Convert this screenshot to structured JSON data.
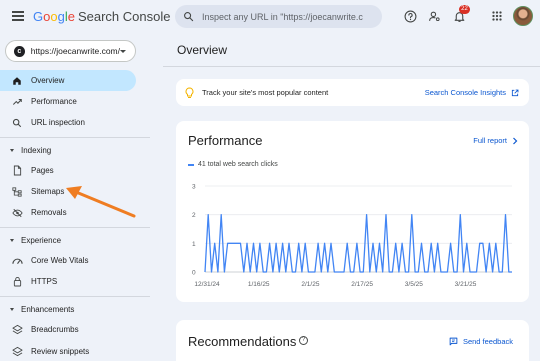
{
  "app": {
    "logo_google": [
      "G",
      "o",
      "o",
      "g",
      "l",
      "e"
    ],
    "logo_product": "Search Console"
  },
  "search": {
    "placeholder": "Inspect any URL in \"https://joecanwrite.c"
  },
  "topbar": {
    "icons": [
      "help-icon",
      "manage-users-icon",
      "notifications-icon",
      "apps-grid-icon"
    ],
    "notification_count": "22"
  },
  "property": {
    "url": "https://joecanwrite.com/"
  },
  "sidebar": {
    "items": [
      {
        "label": "Overview",
        "icon": "home-icon",
        "active": true
      },
      {
        "label": "Performance",
        "icon": "trending-icon"
      },
      {
        "label": "URL inspection",
        "icon": "search-icon"
      }
    ],
    "indexing": {
      "label": "Indexing",
      "items": [
        {
          "label": "Pages",
          "icon": "page-icon"
        },
        {
          "label": "Sitemaps",
          "icon": "sitemap-icon"
        },
        {
          "label": "Removals",
          "icon": "removals-icon"
        }
      ]
    },
    "experience": {
      "label": "Experience",
      "items": [
        {
          "label": "Core Web Vitals",
          "icon": "gauge-icon"
        },
        {
          "label": "HTTPS",
          "icon": "lock-icon"
        }
      ]
    },
    "enhancements": {
      "label": "Enhancements",
      "items": [
        {
          "label": "Breadcrumbs",
          "icon": "layers-icon"
        },
        {
          "label": "Review snippets",
          "icon": "layers-icon"
        }
      ]
    }
  },
  "main": {
    "title": "Overview",
    "tip": {
      "text": "Track your site's most popular content",
      "link": "Search Console Insights"
    },
    "performance": {
      "title": "Performance",
      "full_report": "Full report",
      "legend": "41 total web search clicks"
    },
    "recommendations": {
      "title": "Recommendations",
      "help": "?",
      "feedback": "Send feedback"
    }
  },
  "colors": {
    "accent": "#0b57d0",
    "active_nav": "#c2e7ff",
    "series": "#4285f4",
    "arrow": "#ef7d22",
    "badge": "#d93025"
  },
  "chart_data": {
    "type": "line",
    "title": "Performance",
    "series": [
      {
        "name": "41 total web search clicks",
        "values": [
          0,
          2,
          0,
          1,
          0,
          2,
          0,
          1,
          1,
          1,
          1,
          1,
          0,
          1,
          0,
          1,
          0,
          1,
          0,
          0,
          1,
          0,
          1,
          0,
          1,
          0,
          1,
          0,
          0,
          1,
          0,
          1,
          0,
          0,
          0,
          1,
          0,
          1,
          0,
          1,
          0,
          0,
          0,
          0,
          1,
          0,
          0,
          1,
          0,
          0,
          2,
          0,
          1,
          0,
          1,
          0,
          2,
          0,
          0,
          1,
          0,
          1,
          0,
          0,
          2,
          0,
          0,
          1,
          0,
          0,
          1,
          0,
          1,
          0,
          0,
          0,
          1,
          0,
          0,
          2,
          0,
          1,
          0,
          0,
          0,
          1,
          1,
          0,
          1,
          0,
          1,
          0,
          0,
          2,
          0,
          0
        ]
      }
    ],
    "x_ticks": [
      "12/31/24",
      "1/16/25",
      "2/1/25",
      "2/17/25",
      "3/5/25",
      "3/21/25"
    ],
    "y_ticks": [
      "0",
      "1",
      "2",
      "3"
    ],
    "ylim": [
      0,
      3
    ],
    "grid": true,
    "legend": "top-left"
  }
}
